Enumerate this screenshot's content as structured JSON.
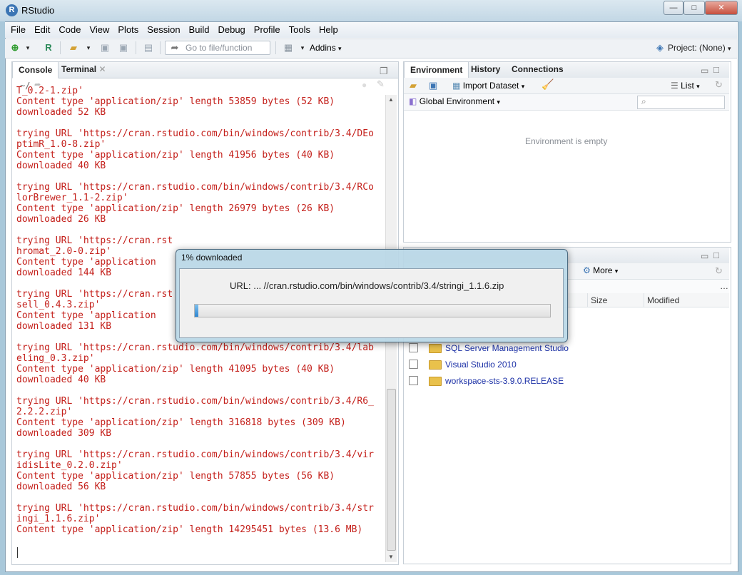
{
  "window": {
    "title": "RStudio",
    "app_icon": "R",
    "controls": [
      "—",
      "□",
      "✕"
    ]
  },
  "menubar": {
    "items": [
      "File",
      "Edit",
      "Code",
      "View",
      "Plots",
      "Session",
      "Build",
      "Debug",
      "Profile",
      "Tools",
      "Help"
    ]
  },
  "toolbar": {
    "goto_placeholder": "Go to file/function",
    "addins_label": "Addins",
    "project_label": "Project: (None)"
  },
  "left_pane": {
    "tabs": [
      {
        "label": "Console",
        "active": true
      },
      {
        "label": "Terminal",
        "active": false
      }
    ],
    "console_path": "~/",
    "console_lines": [
      "T_0.2-1.zip'",
      "Content type 'application/zip' length 53859 bytes (52 KB)",
      "downloaded 52 KB",
      "",
      "trying URL 'https://cran.rstudio.com/bin/windows/contrib/3.4/DEo",
      "ptimR_1.0-8.zip'",
      "Content type 'application/zip' length 41956 bytes (40 KB)",
      "downloaded 40 KB",
      "",
      "trying URL 'https://cran.rstudio.com/bin/windows/contrib/3.4/RCo",
      "lorBrewer_1.1-2.zip'",
      "Content type 'application/zip' length 26979 bytes (26 KB)",
      "downloaded 26 KB",
      "",
      "trying URL 'https://cran.rst",
      "hromat_2.0-0.zip'",
      "Content type 'application",
      "downloaded 144 KB",
      "",
      "trying URL 'https://cran.rst",
      "sell_0.4.3.zip'",
      "Content type 'application",
      "downloaded 131 KB",
      "",
      "trying URL 'https://cran.rstudio.com/bin/windows/contrib/3.4/lab",
      "eling_0.3.zip'",
      "Content type 'application/zip' length 41095 bytes (40 KB)",
      "downloaded 40 KB",
      "",
      "trying URL 'https://cran.rstudio.com/bin/windows/contrib/3.4/R6_",
      "2.2.2.zip'",
      "Content type 'application/zip' length 316818 bytes (309 KB)",
      "downloaded 309 KB",
      "",
      "trying URL 'https://cran.rstudio.com/bin/windows/contrib/3.4/vir",
      "idisLite_0.2.0.zip'",
      "Content type 'application/zip' length 57855 bytes (56 KB)",
      "downloaded 56 KB",
      "",
      "trying URL 'https://cran.rstudio.com/bin/windows/contrib/3.4/str",
      "ingi_1.1.6.zip'",
      "Content type 'application/zip' length 14295451 bytes (13.6 MB)"
    ]
  },
  "env_pane": {
    "tabs": [
      {
        "label": "Environment",
        "active": true
      },
      {
        "label": "History",
        "active": false
      },
      {
        "label": "Connections",
        "active": false
      }
    ],
    "import_label": "Import Dataset",
    "list_label": "List",
    "scope_label": "Global Environment",
    "empty_text": "Environment is empty"
  },
  "files_pane": {
    "more_label": "More",
    "columns": {
      "size": "Size",
      "modified": "Modified"
    },
    "rows": [
      "SQL Server Management Studio",
      "Visual Studio 2010",
      "workspace-sts-3.9.0.RELEASE"
    ]
  },
  "dialog": {
    "title": "1% downloaded",
    "url": "URL: ... //cran.rstudio.com/bin/windows/contrib/3.4/stringi_1.1.6.zip",
    "progress": 0.01
  },
  "colors": {
    "console_text": "#c4201b",
    "link": "#1a2fa6",
    "progress": "#2f86d0"
  }
}
